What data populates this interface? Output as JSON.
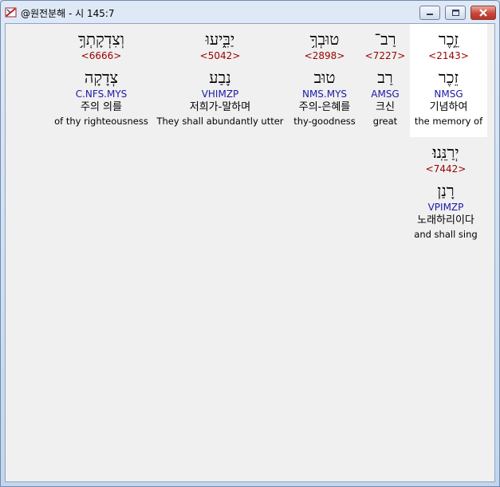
{
  "window": {
    "title": "@원전분해 - 시 145:7",
    "icon": "bible-app-icon"
  },
  "words": [
    {
      "hebrew": "זֵ֣כֶר",
      "strongs": "<2143>",
      "lemma": "זֵכֶר",
      "morph": "NMSG",
      "korean": "기념하여",
      "english": "the memory of",
      "highlight": true
    },
    {
      "hebrew": "רַב־",
      "strongs": "<7227>",
      "lemma": "רַב",
      "morph": "AMSG",
      "korean": "크신",
      "english": "great",
      "highlight": false
    },
    {
      "hebrew": "טוּבְךָ֥",
      "strongs": "<2898>",
      "lemma": "טוּב",
      "morph": "NMS.MYS",
      "korean": "주의-은혜를",
      "english": "thy-goodness",
      "highlight": false
    },
    {
      "hebrew": "יַבִּ֑יעוּ",
      "strongs": "<5042>",
      "lemma": "נָבַע",
      "morph": "VHIMZP",
      "korean": "저희가-말하며",
      "english": "They shall abundantly utter",
      "highlight": false
    },
    {
      "hebrew": "וְצִדְקָתְךָ֥",
      "strongs": "<6666>",
      "lemma": "צְדָקָה",
      "morph": "C.NFS.MYS",
      "korean": "주의 의를",
      "english": "of thy righteousness",
      "highlight": false
    },
    {
      "hebrew": "יְרַנֵּֽנוּ׃",
      "strongs": "<7442>",
      "lemma": "רָנַן",
      "morph": "VPIMZP",
      "korean": "노래하리이다",
      "english": "and shall sing",
      "highlight": false
    }
  ]
}
